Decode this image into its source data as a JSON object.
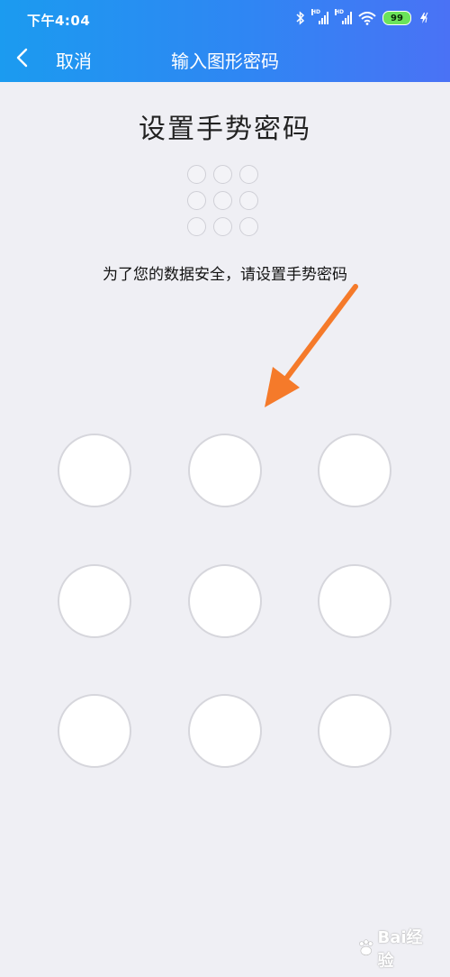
{
  "status_bar": {
    "time": "下午4:04",
    "signal_tag": "HD",
    "battery_level": "99"
  },
  "nav": {
    "cancel_label": "取消",
    "title": "输入图形密码"
  },
  "content": {
    "heading": "设置手势密码",
    "hint": "为了您的数据安全，请设置手势密码"
  },
  "pattern": {
    "rows": 3,
    "cols": 3,
    "preview_selected": [],
    "selected": []
  },
  "annotation": {
    "color": "#f57a2a"
  },
  "colors": {
    "header_start": "#1b9bf0",
    "header_end": "#4a72f5",
    "background": "#efeff4",
    "node_fill": "#ffffff",
    "node_border": "#d6d6dc"
  },
  "watermark": {
    "text": "Bai经验"
  }
}
